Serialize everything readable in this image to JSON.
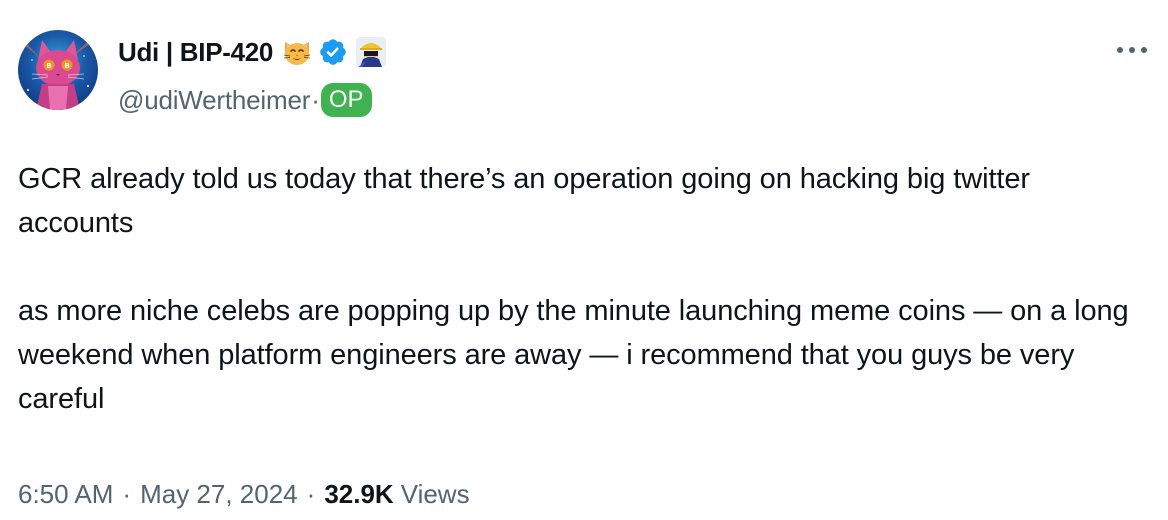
{
  "author": {
    "display_name": "Udi | BIP-420",
    "handle": "@udiWertheimer",
    "handle_separator": "·",
    "op_label": "OP",
    "badges": [
      "cat-face-emoji-icon",
      "verified-checkmark-icon",
      "affiliate-org-icon"
    ]
  },
  "tweet": {
    "paragraphs": [
      "GCR already told us today that there’s an operation going on hacking big twitter accounts",
      "as more niche celebs are popping up by the minute launching meme coins — on a long weekend when platform engineers are away — i recommend that you guys be very careful"
    ],
    "time": "6:50 AM",
    "date": "May 27, 2024",
    "separator": "·",
    "views_count": "32.9K",
    "views_label": "Views"
  },
  "actions": {
    "more_icon": "more-horizontal-icon"
  },
  "colors": {
    "text_primary": "#0f1419",
    "text_secondary": "#536471",
    "verified_blue": "#1d9bf0",
    "op_green": "#3eb34f",
    "background": "#ffffff"
  }
}
